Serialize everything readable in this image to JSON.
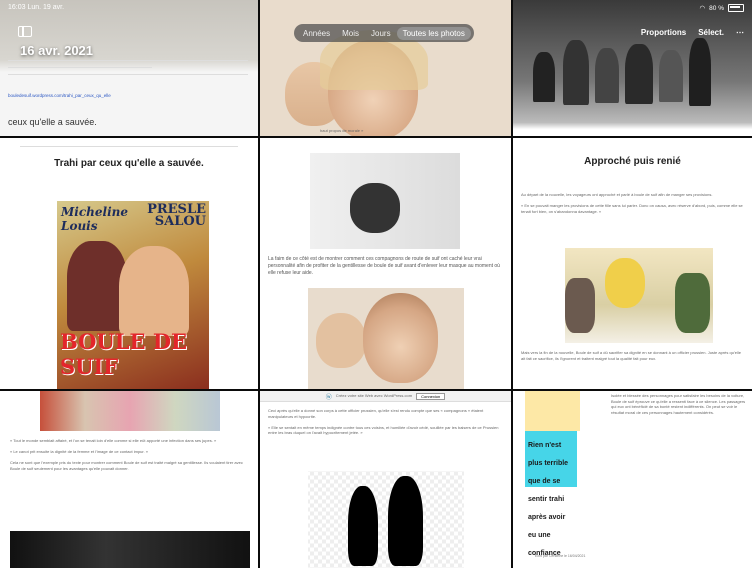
{
  "status_bar": {
    "time": "16:03  Lun. 19 avr.",
    "battery": "80 %"
  },
  "header": {
    "date": "16 avr. 2021",
    "segments": [
      "Années",
      "Mois",
      "Jours",
      "Toutes les photos"
    ],
    "active_segment": "Toutes les photos",
    "actions": [
      "Proportions",
      "Sélect.",
      "⋯"
    ]
  },
  "tiles": {
    "t1": {
      "link": "bouledesuif.wordpress.com/trahi_par_ceux_qu_elle",
      "text": "ceux qu'elle a sauvée."
    },
    "t2": {
      "caption": "haut propos de morale »"
    },
    "t4": {
      "title": "Trahi par ceux qu'elle a sauvée.",
      "poster_name1": "Micheline",
      "poster_name1b": "Louis",
      "poster_name2a": "PRESLE",
      "poster_name2b": "SALOU",
      "poster_title": "BOULE DE SUIF"
    },
    "t5": {
      "text": "La faim de ce côté est de montrer comment ces compagnons de route de suif ont caché leur vrai personnalité afin de profiter de la gentillesse de boule de suif avant d'enlever leur masque au moment où elle refuse leur aide."
    },
    "t6": {
      "title": "Approché puis renié",
      "intro": "Au départ de la nouvelle, les voyageurs ont approché et parlé à boule de suif afin de manger ses provisions.",
      "quote": "« En se pouvait manger les provisions de cette fille sans lui parler. Donc on causa, avec réserve d'abord, puis, comme elle se tenait fort bien, on s'abandonna davantage. »",
      "end": "Mais vers la fin de la nouvelle, Boule de suif a dû sacrifier sa dignité en se donnant à un officier prussien. Juste après qu'elle ait fait ce sacrifice, ils l'ignorent et traitent malgré tout la qualité fait pour eux."
    },
    "t7": {
      "quote": "« Tout le monde semblait affairé, et l'on se tenait loin d'elle comme si elle eût apporté une infection dans ses jupes. »",
      "middle": "« Le canot prit ensuite la dignité de la femme et l'image de ce contact impur. »",
      "end": "Cela ne sont que l'exemple pris du texte pour montrer comment Boule de suif est traité malgré sa gentillesse. Ils voulaient tirer avec Boule de suif seulement pour les avantages qu'elle pouvait donner."
    },
    "t8": {
      "wp": "Créez votre site Web avec WordPress.com",
      "connect": "Connexion",
      "p1": "Ceci après qu'elle a donné son corps à cette officier prussien, qu'elle s'est rendu compte que ses « compagnons » étaient manipulateurs et hypocrite.",
      "p2": "« Elle se sentait en même temps indignée contre tous ces voisins, et humiliée d'avoir cédé, souillée par les baisers de ce Prussien entre les bras duquel on l'avait hypocritement jetée. »"
    },
    "t9": {
      "poster": "Rien n'est plus terrible que de se sentir trahi après avoir eu une confiance aveugle.",
      "col": "Isolée et blessée des personnages pour satisfaire les besoins de la voiture, Boule de suif éprouve ce qu'elle a ressenti face à ce silence. Les passagers qui eux ont bénéficié de sa bonté restent indifférents. On peut se voir le résultat moral de ces personnages hautement considérés.",
      "caption": "Écrit par Cendrine le 16/04/2021"
    }
  }
}
